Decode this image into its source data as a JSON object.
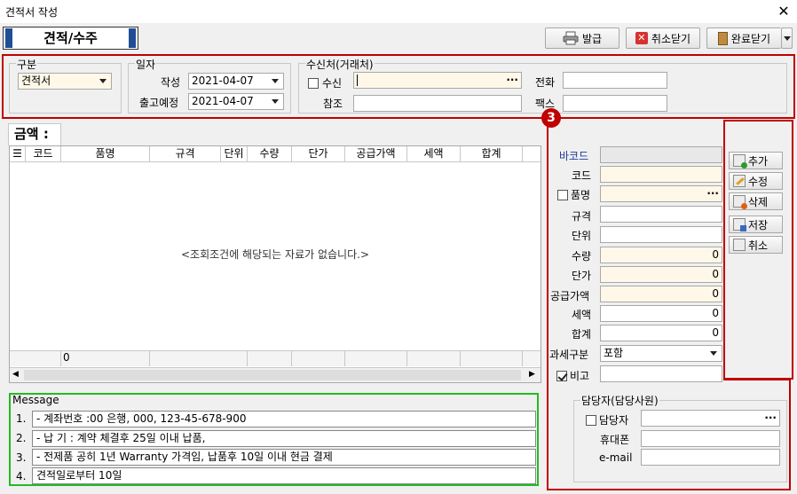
{
  "window": {
    "title": "견적서 작성"
  },
  "header_tab": {
    "label": "견적/수주"
  },
  "toolbar": {
    "issue": "발급",
    "cancel_close": "취소닫기",
    "complete_close": "완료닫기"
  },
  "section": {
    "gubun_label": "구분",
    "gubun_value": "견적서",
    "date_label": "일자",
    "write_label": "작성",
    "write_value": "2021-04-07",
    "ship_label": "출고예정",
    "ship_value": "2021-04-07",
    "recv_group": "수신처(거래처)",
    "recv_label": "수신",
    "ref_label": "참조",
    "phone_label": "전화",
    "fax_label": "팩스",
    "dots": "···"
  },
  "amount": {
    "label": "금액 :"
  },
  "grid": {
    "columns": [
      "코드",
      "품명",
      "규격",
      "단위",
      "수량",
      "단가",
      "공급가액",
      "세액",
      "합계"
    ],
    "empty_text": "<조회조건에 해당되는 자료가 없습니다.>",
    "footer_value": "0"
  },
  "badge": "3",
  "detail": {
    "barcode": "바코드",
    "code": "코드",
    "name": "품명",
    "spec": "규격",
    "unit": "단위",
    "qty": "수량",
    "price": "단가",
    "supply": "공급가액",
    "tax": "세액",
    "total": "합계",
    "tax_type": "과세구분",
    "tax_type_value": "포함",
    "remark": "비고",
    "qty_value": "0",
    "price_value": "0",
    "supply_value": "0",
    "tax_value": "0",
    "total_value": "0",
    "dots": "···"
  },
  "sidebuttons": [
    "추가",
    "수정",
    "삭제",
    "저장",
    "취소"
  ],
  "message": {
    "label": "Message",
    "rows": [
      {
        "num": "1.",
        "text": "- 계좌번호 :00 은행, 000, 123-45-678-900"
      },
      {
        "num": "2.",
        "text": "- 납 기 : 계약 체결후 25일 이내 납품,"
      },
      {
        "num": "3.",
        "text": "- 전제품 공히 1년 Warranty 가격임, 납품후 10일 이내 현금 결제"
      },
      {
        "num": "4.",
        "text": "견적일로부터 10일"
      }
    ]
  },
  "manager": {
    "group": "담당자(담당사원)",
    "manager_label": "담당자",
    "mobile_label": "휴대폰",
    "email_label": "e-mail",
    "dots": "···"
  }
}
